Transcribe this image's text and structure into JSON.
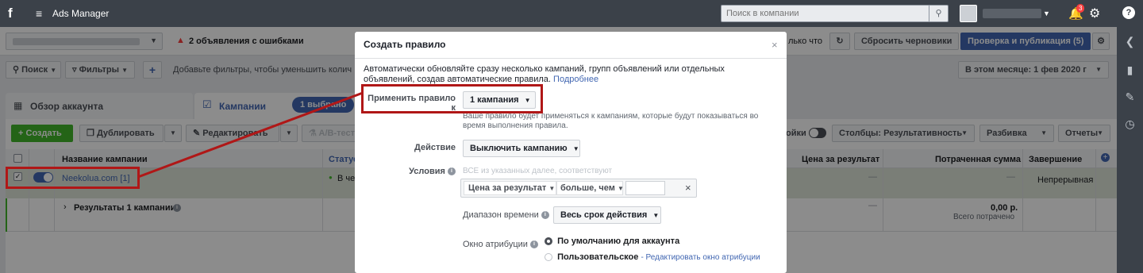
{
  "topbar": {
    "logo": "f",
    "menu_icon": "≡",
    "app_title": "Ads Manager",
    "search_placeholder": "Поиск в компании",
    "notifications_count": "3"
  },
  "subheader": {
    "error_text": "2 объявления с ошибками",
    "truncated_text": "лько что",
    "discard_label": "Сбросить черновики",
    "publish_label": "Проверка и публикация (5)"
  },
  "filterbar": {
    "search_label": "Поиск",
    "filters_label": "Фильтры",
    "add_filter_text": "Добавьте фильтры, чтобы уменьшить колич",
    "date_range": "В этом месяце: 1 фев 2020 г"
  },
  "tabs": {
    "account_overview": "Обзор аккаунта",
    "campaigns": "Кампании",
    "selected_badge": "1 выбрано"
  },
  "toolbar": {
    "create_label": "Создать",
    "duplicate_label": "Дублировать",
    "edit_label": "Редактировать",
    "ab_test_label": "A/B-тест",
    "toggle_label": "ойки",
    "columns_label": "Столбцы: Результативность",
    "breakdown_label": "Разбивка",
    "reports_label": "Отчеты"
  },
  "table": {
    "col_campaign_name": "Название кампании",
    "col_status": "Статус",
    "col_cost_per_result": "Цена за результат",
    "col_amount_spent": "Потраченная сумма",
    "col_ends": "Завершение",
    "row": {
      "name": "Neekolua.com [1]",
      "status": "В че",
      "cost": "—",
      "spent": "—",
      "ends": "Непрерывная"
    },
    "summary": {
      "label": "Результаты 1 кампании",
      "cost": "—",
      "spent_value": "0,00 р.",
      "spent_caption": "Всего потрачено"
    }
  },
  "modal": {
    "title": "Создать правило",
    "close_symbol": "×",
    "description": "Автоматически обновляйте сразу несколько кампаний, групп объявлений или отдельных объявлений, создав автоматические правила.",
    "learn_more": "Подробнее",
    "apply_to_label": "Применить правило к",
    "apply_to_value": "1 кампания",
    "apply_hint": "Ваше правило будет применяться к кампаниям, которые будут показываться во время выполнения правила.",
    "action_label": "Действие",
    "action_value": "Выключить кампанию",
    "conditions_label": "Условия",
    "conditions_hint": "ВСЕ из указанных далее, соответствуют",
    "condition_metric": "Цена за результат",
    "condition_operator": "больше, чем",
    "condition_value": "",
    "time_range_label": "Диапазон времени",
    "time_range_value": "Весь срок действия",
    "attribution_label": "Окно атрибуции",
    "attribution_default": "По умолчанию для аккаунта",
    "attribution_custom": "Пользовательское",
    "attribution_edit": "- Редактировать окно атрибуции"
  },
  "colors": {
    "annotation_red": "#b01717",
    "brand_blue": "#4267b2",
    "create_green": "#42b72a",
    "topbar": "#3b4149"
  }
}
